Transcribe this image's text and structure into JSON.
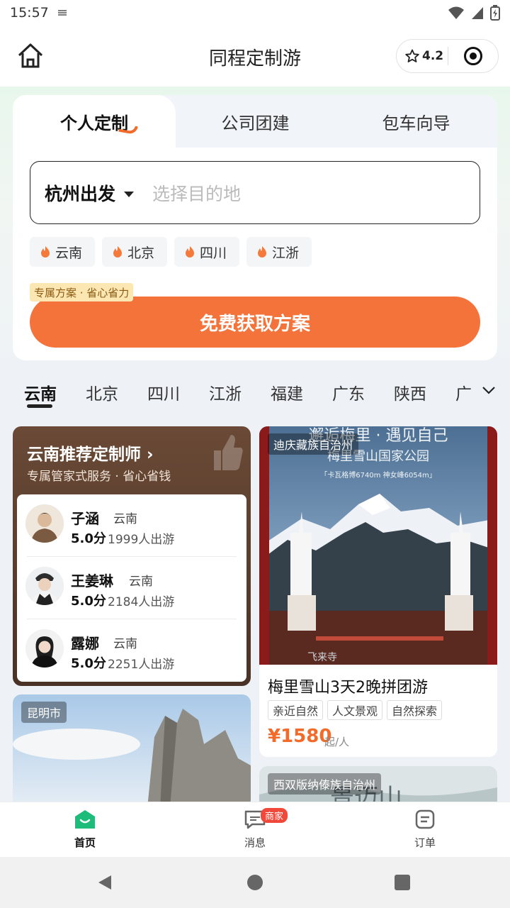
{
  "status_bar": {
    "time": "15:57"
  },
  "nav": {
    "title": "同程定制游",
    "rating": "4.2"
  },
  "service_tabs": [
    {
      "label": "个人定制",
      "active": true
    },
    {
      "label": "公司团建",
      "active": false
    },
    {
      "label": "包车向导",
      "active": false
    }
  ],
  "destination": {
    "from": "杭州出发",
    "placeholder": "选择目的地"
  },
  "hot_chips": [
    "云南",
    "北京",
    "四川",
    "江浙"
  ],
  "promo": {
    "tag": "专属方案 · 省心省力",
    "button": "免费获取方案"
  },
  "city_tabs": [
    "云南",
    "北京",
    "四川",
    "江浙",
    "福建",
    "广东",
    "陕西",
    "广"
  ],
  "planner_card": {
    "title": "云南推荐定制师 ›",
    "subtitle": "专属管家式服务 · 省心省钱",
    "planners": [
      {
        "name": "子涵",
        "region": "云南",
        "score": "5.0分",
        "count": "1999人出游"
      },
      {
        "name": "王姜琳",
        "region": "云南",
        "score": "5.0分",
        "count": "2184人出游"
      },
      {
        "name": "露娜",
        "region": "云南",
        "score": "5.0分",
        "count": "2251人出游"
      }
    ]
  },
  "product_card": {
    "location": "迪庆藏族自治州",
    "image_text_1": "邂逅梅里 · 遇见自己",
    "image_text_2": "梅里雪山国家公园",
    "image_text_3": "「卡瓦格博6740m 神女峰6054m」",
    "image_text_4": "飞来寺",
    "title": "梅里雪山3天2晚拼团游",
    "tags": [
      "亲近自然",
      "人文景观",
      "自然探索"
    ],
    "price": "¥1580",
    "price_unit": "起/人"
  },
  "second_row": {
    "left_location": "昆明市",
    "right_location": "西双版纳傣族自治州",
    "right_image_text": "景迈山"
  },
  "tab_bar": [
    {
      "label": "首页",
      "active": true
    },
    {
      "label": "消息",
      "badge": "商家"
    },
    {
      "label": "订单"
    }
  ]
}
